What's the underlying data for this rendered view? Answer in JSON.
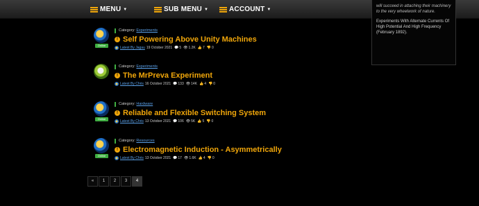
{
  "nav": {
    "menu_label": "MENU",
    "submenu_label": "SUB MENU",
    "account_label": "ACCOUNT"
  },
  "sidebar": {
    "quote": "will succeed in attaching their machinery to the very wheelwork of nature.",
    "text": "Experiments With Alternate Currents Of High Potential And High Frequency (February 1892)."
  },
  "posts": [
    {
      "status": "Online",
      "category_prefix": "Category:",
      "category": "Experiments",
      "title": "Self Powering Above Unity Machines",
      "author": "Latest By Jagau",
      "date": "19 October 2021",
      "comments": "5",
      "views": "1.2K",
      "likes": "7",
      "dislikes": "0"
    },
    {
      "status": "",
      "category_prefix": "Category:",
      "category": "Experiments",
      "title": "The MrPreva Experiment",
      "author": "Latest By Chris",
      "date": "16 October 2021",
      "comments": "133",
      "views": "14K",
      "likes": "4",
      "dislikes": "0"
    },
    {
      "status": "Online",
      "category_prefix": "Category:",
      "category": "Hardware",
      "title": "Reliable and Flexible Switching System",
      "author": "Latest By Chris",
      "date": "13 October 2021",
      "comments": "106",
      "views": "5K",
      "likes": "5",
      "dislikes": "0"
    },
    {
      "status": "Online",
      "category_prefix": "Category:",
      "category": "Resources",
      "title": "Electromagnetic Induction - Asymmetrically",
      "author": "Latest By Chris",
      "date": "13 October 2021",
      "comments": "17",
      "views": "1.6K",
      "likes": "4",
      "dislikes": "0"
    }
  ],
  "pagination": {
    "prev": "«",
    "pages": [
      "1",
      "2",
      "3",
      "4"
    ],
    "current": "4"
  },
  "icons": {
    "comments": "💬",
    "views": "👁",
    "likes": "👍",
    "dislikes": "👎",
    "title": "!"
  },
  "colors": {
    "accent": "#f0a60a",
    "link": "#5aa0e8",
    "online": "#3fae42"
  }
}
